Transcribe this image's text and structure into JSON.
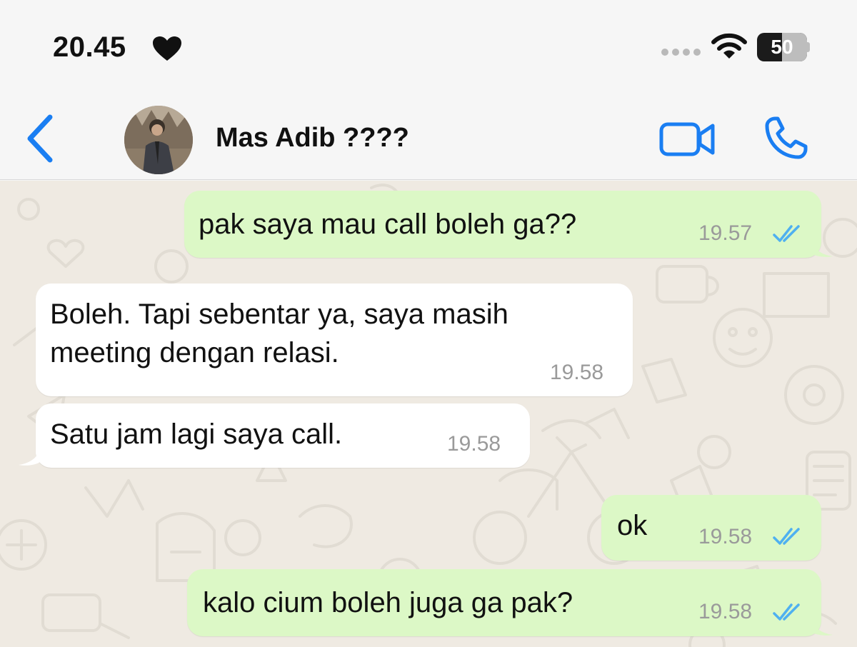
{
  "status_bar": {
    "time": "20.45",
    "battery": "50"
  },
  "header": {
    "contact_name": "Mas Adib ????"
  },
  "messages": [
    {
      "direction": "out",
      "text": "pak saya mau call boleh ga??",
      "time": "19.57",
      "read": true
    },
    {
      "direction": "in",
      "text": "Boleh. Tapi sebentar ya, saya masih\nmeeting dengan relasi.",
      "time": "19.58"
    },
    {
      "direction": "in",
      "text": "Satu jam lagi saya call.",
      "time": "19.58"
    },
    {
      "direction": "out",
      "text": "ok",
      "time": "19.58",
      "read": true
    },
    {
      "direction": "out",
      "text": "kalo cium boleh juga ga pak?",
      "time": "19.58",
      "read": true
    }
  ],
  "colors": {
    "accent": "#1a7ef2",
    "outgoing_bubble": "#dcf8c6",
    "incoming_bubble": "#ffffff",
    "chat_background": "#efeae2",
    "read_ticks": "#4fb0f0"
  }
}
